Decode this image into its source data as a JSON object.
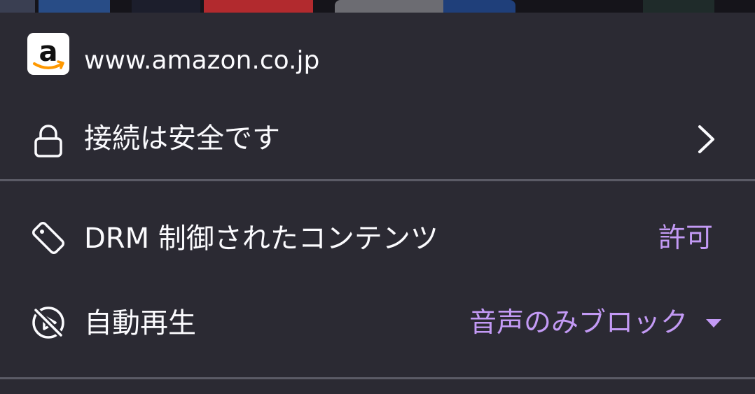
{
  "site": {
    "url": "www.amazon.co.jp",
    "favicon_icon": "amazon-logo-icon",
    "favicon_letter": "a"
  },
  "security": {
    "label": "接続は安全です",
    "icon": "lock-icon",
    "arrow_icon": "chevron-right-icon"
  },
  "drm": {
    "label": "DRM 制御されたコンテンツ",
    "value": "許可",
    "icon": "drm-tag-icon"
  },
  "autoplay": {
    "label": "自動再生",
    "value": "音声のみブロック",
    "icon": "autoplay-blocked-icon",
    "dropdown_icon": "dropdown-triangle-icon"
  },
  "colors": {
    "panel_background": "#2b2a33",
    "text": "#fbfbfe",
    "accent": "#c39af5",
    "divider": "#5b5b66",
    "amazon_smile": "#ff9900"
  }
}
